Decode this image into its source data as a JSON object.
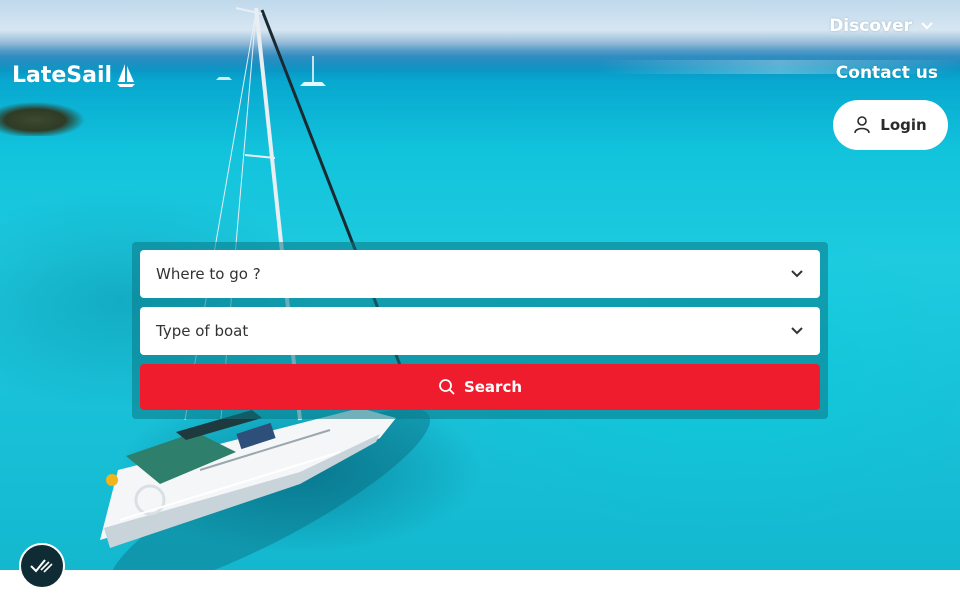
{
  "brand": {
    "name": "LateSail",
    "logo_icon": "sailboat-icon"
  },
  "nav": {
    "discover_label": "Discover",
    "discover_icon": "chevron-down-icon",
    "contact_label": "Contact us",
    "login_label": "Login",
    "login_icon": "user-icon"
  },
  "search": {
    "destination_placeholder": "Where to go ?",
    "boat_type_placeholder": "Type of boat",
    "dropdown_icon": "chevron-down-icon",
    "button_label": "Search",
    "button_icon": "search-icon"
  },
  "cookie_badge": {
    "icon": "checklist-icon"
  },
  "colors": {
    "accent": "#ef1c2e",
    "panel": "#0a7887",
    "badge": "#0f2b33",
    "text_dark": "#333333",
    "white": "#ffffff"
  }
}
